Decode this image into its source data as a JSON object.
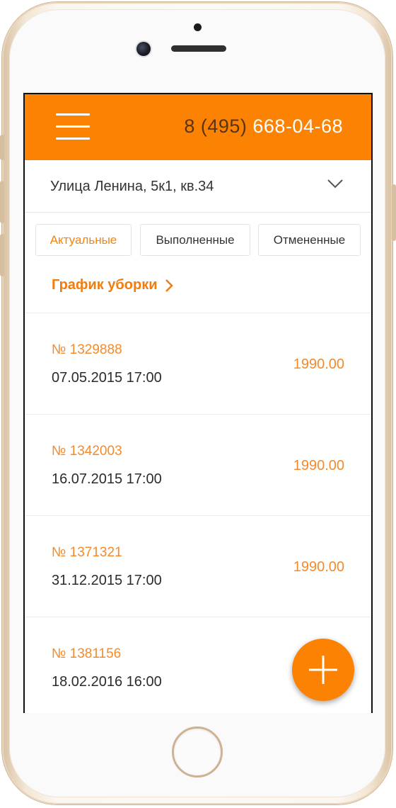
{
  "header": {
    "phone_prefix": "8 (495)",
    "phone_main": "668-04-68",
    "menu_icon": "hamburger-menu-icon",
    "background_color": "#fc8203"
  },
  "address": {
    "value": "Улица Ленина, 5к1, кв.34",
    "dropdown_icon": "chevron-down-icon"
  },
  "tabs": [
    {
      "label": "Актуальные",
      "active": true
    },
    {
      "label": "Выполненные",
      "active": false
    },
    {
      "label": "Отмененные",
      "active": false
    }
  ],
  "schedule": {
    "label": "График уборки",
    "icon": "chevron-right-icon"
  },
  "orders": [
    {
      "number": "№ 1329888",
      "datetime": "07.05.2015 17:00",
      "price": "1990.00"
    },
    {
      "number": "№ 1342003",
      "datetime": "16.07.2015 17:00",
      "price": "1990.00"
    },
    {
      "number": "№ 1371321",
      "datetime": "31.12.2015 17:00",
      "price": "1990.00"
    },
    {
      "number": "№ 1381156",
      "datetime": "18.02.2016 16:00",
      "price": ""
    }
  ],
  "fab": {
    "icon": "plus-icon"
  },
  "colors": {
    "accent": "#fc8203",
    "accent_text": "#f58a2a",
    "text": "#2b2b2b"
  }
}
